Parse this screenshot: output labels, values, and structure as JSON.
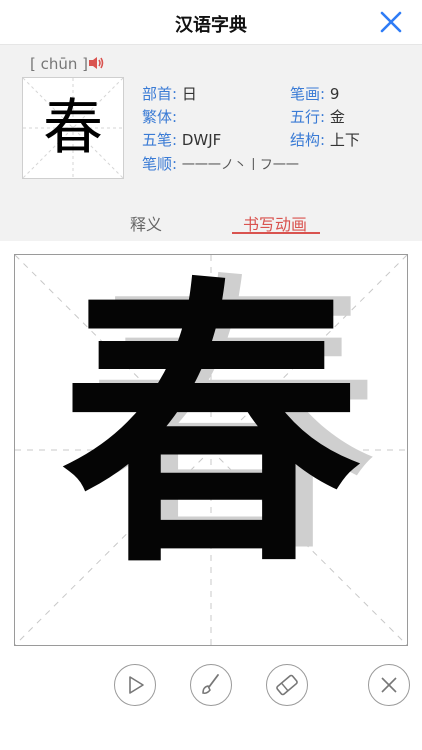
{
  "header": {
    "title": "汉语字典",
    "close_icon": "close-icon",
    "accent_color": "#2e7cf6"
  },
  "entry": {
    "pinyin": "[ chūn ]",
    "character": "春",
    "fields": [
      {
        "key": "部首:",
        "value": "日"
      },
      {
        "key": "笔画:",
        "value": "9"
      },
      {
        "key": "繁体:",
        "value": ""
      },
      {
        "key": "五行:",
        "value": "金"
      },
      {
        "key": "五笔:",
        "value": "DWJF"
      },
      {
        "key": "结构:",
        "value": "上下"
      },
      {
        "key": "笔顺:",
        "value": "一一一ノ丶丨フ一一"
      }
    ]
  },
  "tabs": [
    {
      "label": "释义",
      "active": false
    },
    {
      "label": "书写动画",
      "active": true
    }
  ],
  "board": {
    "character": "春"
  },
  "controls": [
    {
      "name": "play-icon"
    },
    {
      "name": "brush-icon"
    },
    {
      "name": "eraser-icon"
    },
    {
      "name": "close-circle-icon"
    }
  ],
  "colors": {
    "label_blue": "#3a7bd5",
    "tab_active": "#d9534f",
    "panel_bg": "#f2f2f2"
  }
}
